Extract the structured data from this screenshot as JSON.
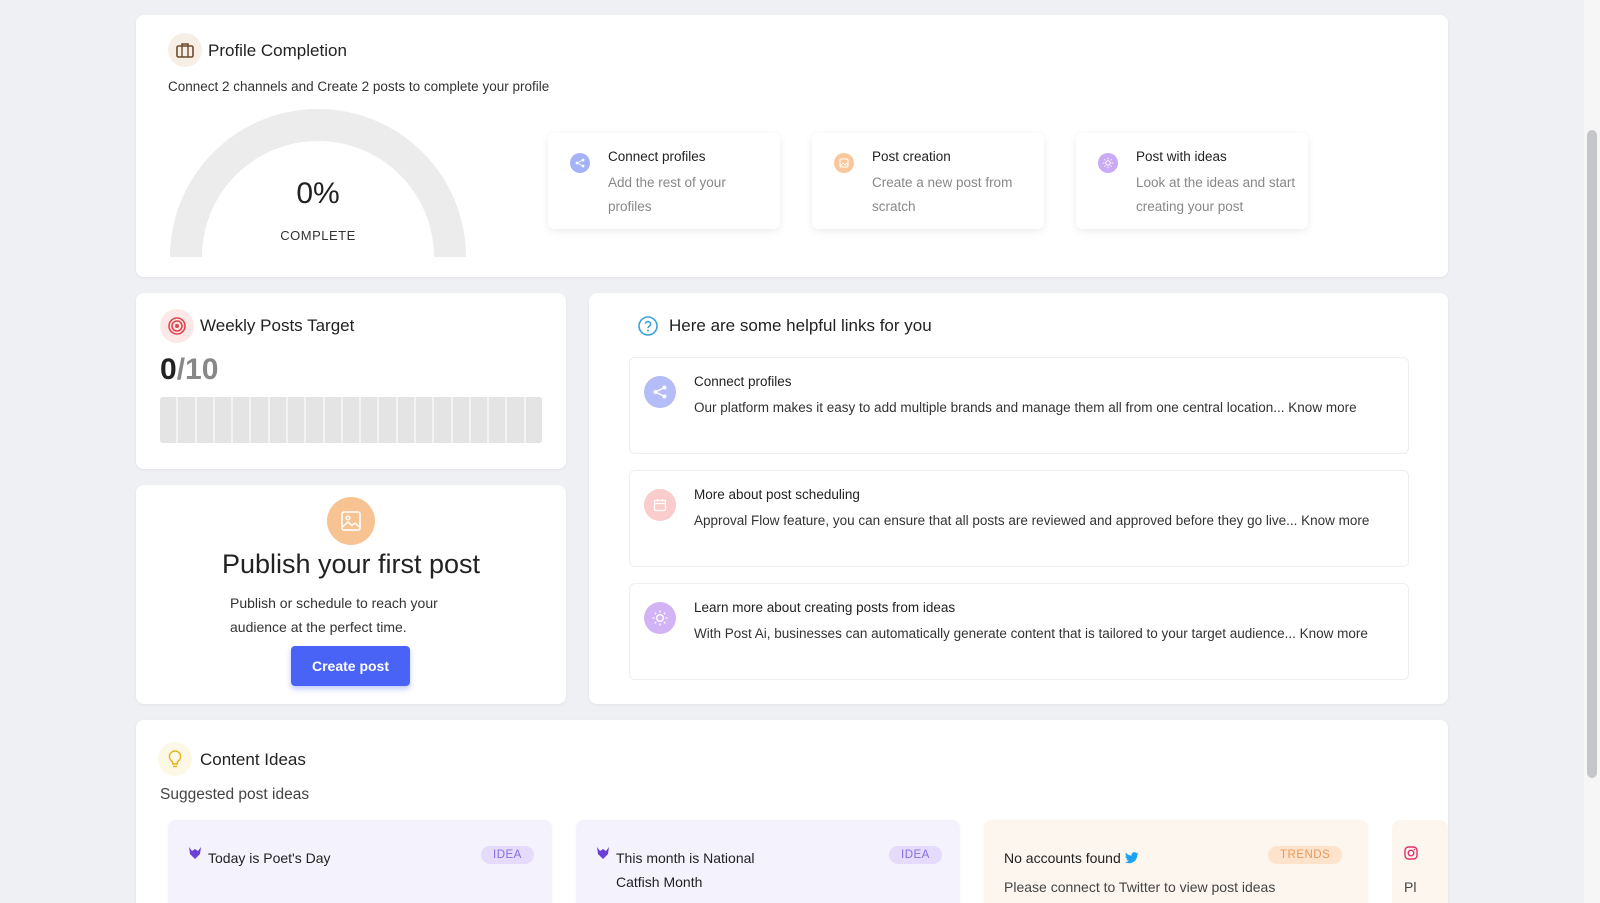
{
  "profile": {
    "title": "Profile Completion",
    "subtitle": "Connect 2 channels and Create 2 posts to complete your profile",
    "percent_label": "0%",
    "percent_value": 0,
    "complete_label": "COMPLETE",
    "steps": [
      {
        "title": "Connect profiles",
        "desc": "Add the rest of your profiles",
        "icon": "share-icon",
        "color": "#9aa8f5"
      },
      {
        "title": "Post creation",
        "desc": "Create a new post from scratch",
        "icon": "image-icon",
        "color": "#f7c392"
      },
      {
        "title": "Post with ideas",
        "desc": "Look at the ideas and start creating your post",
        "icon": "sun-icon",
        "color": "#c6a7f4"
      }
    ]
  },
  "weekly": {
    "title": "Weekly Posts Target",
    "current": "0",
    "total": "/10",
    "progress": 0
  },
  "publish": {
    "title": "Publish your first post",
    "desc": "Publish or schedule to reach your audience at the perfect time.",
    "button": "Create post"
  },
  "links": {
    "title": "Here are some helpful links for you",
    "items": [
      {
        "title": "Connect profiles",
        "desc": "Our platform makes it easy to add multiple brands and manage them all from one central location... Know more",
        "icon": "share-icon",
        "color": "#b7c0f8"
      },
      {
        "title": "More about post scheduling",
        "desc": "Approval Flow feature, you can ensure that all posts are reviewed and approved before they go live... Know more",
        "icon": "calendar-icon",
        "color": "#f9c7c7"
      },
      {
        "title": "Learn more about creating posts from ideas",
        "desc": "With Post Ai, businesses can automatically generate content that is tailored to your target audience... Know more",
        "icon": "sun-icon",
        "color": "#d5b8f6"
      }
    ]
  },
  "ideas": {
    "title": "Content Ideas",
    "subtitle": "Suggested post ideas",
    "cards": [
      {
        "title": "Today is Poet's Day",
        "badge": "IDEA",
        "body": ""
      },
      {
        "title": "This month is National Catfish Month",
        "badge": "IDEA",
        "body": ""
      },
      {
        "title": "No accounts found",
        "badge": "TRENDS",
        "body": "Please connect to Twitter to view post ideas"
      },
      {
        "title": "",
        "badge": "",
        "body": "Pl"
      }
    ]
  },
  "colors": {
    "accent": "#4a63f7",
    "idea_bg": "#f4f3fd",
    "trend_bg": "#fdf6ee"
  }
}
